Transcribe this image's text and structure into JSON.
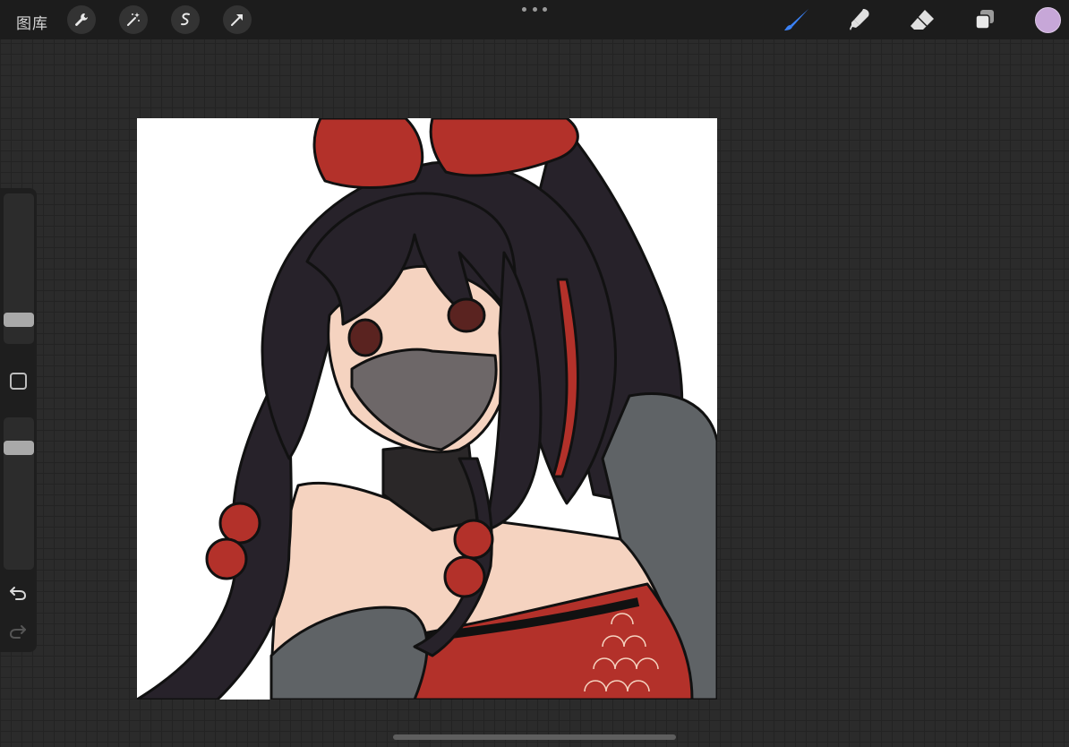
{
  "toolbar": {
    "gallery_label": "图库",
    "left_tools": [
      {
        "icon": "wrench-icon"
      },
      {
        "icon": "magic-wand-icon"
      },
      {
        "icon": "selection-icon"
      },
      {
        "icon": "transform-arrow-icon"
      }
    ],
    "right_tools": [
      {
        "icon": "brush-icon",
        "active": true
      },
      {
        "icon": "smudge-icon"
      },
      {
        "icon": "eraser-icon"
      },
      {
        "icon": "layers-icon"
      }
    ],
    "current_color": "#c7a7d8"
  },
  "sidebar": {
    "brush_size_level": 0.2,
    "opacity_level": 0.8
  },
  "canvas": {
    "background": "#ffffff",
    "artwork": "illustration-girl-with-red-bow"
  },
  "colors": {
    "accent": "#3b82f6",
    "hair": "#27222a",
    "red": "#b3312a",
    "skin": "#f5d3c0",
    "mask": "#6d6768",
    "cloth_gray": "#5f6366"
  }
}
